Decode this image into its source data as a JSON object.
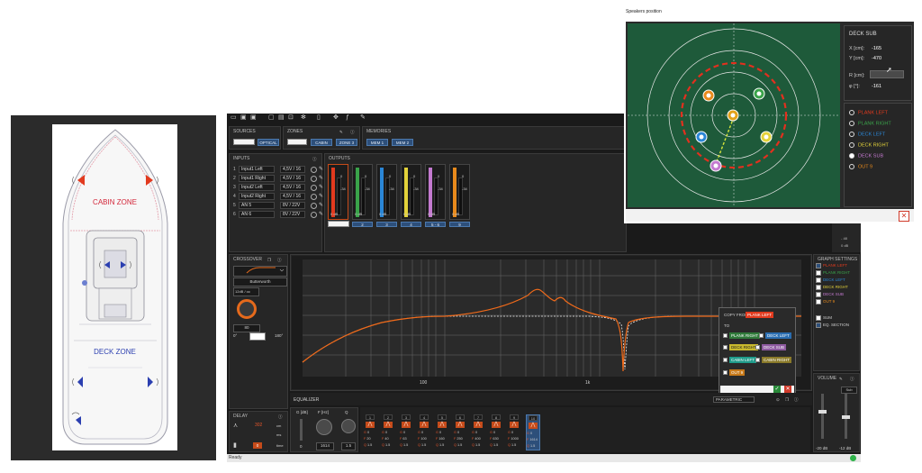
{
  "boat": {
    "cabin_zone_label": "CABIN ZONE",
    "deck_zone_label": "DECK ZONE"
  },
  "sources": {
    "title": "SOURCES",
    "item": "OPTICAL"
  },
  "zones": {
    "title": "ZONES",
    "items": [
      "CABIN",
      "ZONE 3"
    ]
  },
  "memories": {
    "title": "MEMORIES",
    "items": [
      "MEM 1",
      "MEM 2"
    ]
  },
  "inputs": {
    "title": "INPUTS",
    "rows": [
      {
        "num": "1",
        "name": "Input1 Left",
        "gain": "4,5V / 16"
      },
      {
        "num": "2",
        "name": "Input1 Right",
        "gain": "4,5V / 16"
      },
      {
        "num": "3",
        "name": "Input2 Left",
        "gain": "4,5V / 16"
      },
      {
        "num": "4",
        "name": "Input2 Right",
        "gain": "4,5V / 16"
      },
      {
        "num": "5",
        "name": "AN 5",
        "gain": "8V / 22V"
      },
      {
        "num": "6",
        "name": "AN 6",
        "gain": "8V / 22V"
      }
    ]
  },
  "outputs": {
    "title": "OUTPUTS",
    "strips": [
      {
        "color": "#e23a1e",
        "db1": "0",
        "db2": "-34",
        "level": "0 dB",
        "button": "1",
        "highlight": true
      },
      {
        "color": "#3aa34a",
        "db1": "0",
        "db2": "-34",
        "level": "0 dB",
        "button": "2"
      },
      {
        "color": "#2a86d6",
        "db1": "0",
        "db2": "-34",
        "level": "0 dB",
        "button": "3"
      },
      {
        "color": "#e3d23a",
        "db1": "0",
        "db2": "-34",
        "level": "0 dB",
        "button": "4"
      },
      {
        "color": "#c47ad0",
        "db1": "0",
        "db2": "-34",
        "level": "0 dB",
        "button": "5 - 6"
      },
      {
        "color": "#e88a1c",
        "db1": "0",
        "db2": "-34",
        "level": "0 dB",
        "button": "9"
      }
    ]
  },
  "crossover": {
    "title": "CROSSOVER",
    "filter": "Butterworth",
    "slope": "12dB / oc",
    "value": "80",
    "phase_min": "0°",
    "phase_max": "180°"
  },
  "graph": {
    "x_labels": [
      "100",
      "1k"
    ]
  },
  "graph_settings": {
    "title": "GRAPH SETTINGS",
    "items": [
      {
        "label": "PLANK LEFT",
        "color": "#e23a1e",
        "checked": true
      },
      {
        "label": "PLANK RIGHT",
        "color": "#3aa34a",
        "checked": false
      },
      {
        "label": "DECK LEFT",
        "color": "#2a86d6",
        "checked": false
      },
      {
        "label": "DECK RIGHT",
        "color": "#e3d23a",
        "checked": false
      },
      {
        "label": "DECK SUB",
        "color": "#c47ad0",
        "checked": false
      },
      {
        "label": "OUT 9",
        "color": "#e88a1c",
        "checked": false
      }
    ],
    "sum_label": "SUM",
    "eq_section_label": "EQ. SECTION"
  },
  "copy_dialog": {
    "copy_from": "COPY FROM",
    "source": "PLANK LEFT",
    "to_label": "TO",
    "targets": [
      {
        "label": "PLANK RIGHT",
        "color": "#2f7a3a"
      },
      {
        "label": "DECK LEFT",
        "color": "#2a6db0"
      },
      {
        "label": "DECK RIGHT",
        "color": "#c8b92d"
      },
      {
        "label": "DECK SUB",
        "color": "#8e5aa0"
      },
      {
        "label": "CABIN LEFT",
        "color": "#1f9b8a"
      },
      {
        "label": "CABIN RIGHT",
        "color": "#8a7a2a"
      },
      {
        "label": "OUT 9",
        "color": "#c87a1a"
      }
    ]
  },
  "equalizer": {
    "title": "EQUALIZER",
    "mode": "PARAMETRIC",
    "g_label": "G [dB]",
    "f_label": "F [Hz]",
    "q_label": "Q",
    "g_value": "0",
    "f_value": "1614",
    "q_value": "1.5",
    "bands": [
      {
        "n": "1",
        "g": "0",
        "f": "20",
        "q": "1.5"
      },
      {
        "n": "2",
        "g": "0",
        "f": "40",
        "q": "1.5"
      },
      {
        "n": "3",
        "g": "0",
        "f": "63",
        "q": "1.5"
      },
      {
        "n": "4",
        "g": "0",
        "f": "100",
        "q": "1.5"
      },
      {
        "n": "5",
        "g": "0",
        "f": "160",
        "q": "1.5"
      },
      {
        "n": "6",
        "g": "0",
        "f": "250",
        "q": "1.5"
      },
      {
        "n": "7",
        "g": "0",
        "f": "400",
        "q": "1.5"
      },
      {
        "n": "8",
        "g": "0",
        "f": "630",
        "q": "1.5"
      },
      {
        "n": "9",
        "g": "0",
        "f": "1000",
        "q": "1.5"
      },
      {
        "n": "10",
        "g": "0",
        "f": "1614",
        "q": "1.5",
        "selected": true
      }
    ]
  },
  "delay": {
    "title": "DELAY",
    "value": "0",
    "unit_cm": "cm",
    "unit_ms": "ms",
    "unit_time": "time",
    "color_value": "302"
  },
  "volume": {
    "title": "VOLUME",
    "level1": "-20 dB",
    "level2": "-12 dB",
    "top_value": "Sub"
  },
  "status": {
    "text": "Ready"
  },
  "speakers": {
    "window_title": "Speakers position",
    "selected_title": "DECK SUB",
    "x_label": "X [cm]:",
    "x_value": "-165",
    "y_label": "Y [cm]:",
    "y_value": "-470",
    "r_label": "R [cm]:",
    "phi_label": "φ [°]:",
    "phi_value": "-161",
    "list": [
      {
        "label": "PLANK LEFT",
        "color": "#e23a1e"
      },
      {
        "label": "PLANK RIGHT",
        "color": "#3aa34a"
      },
      {
        "label": "DECK LEFT",
        "color": "#2a86d6"
      },
      {
        "label": "DECK RIGHT",
        "color": "#e3d23a"
      },
      {
        "label": "DECK SUB",
        "color": "#c47ad0",
        "selected": true
      },
      {
        "label": "OUT 9",
        "color": "#e88a1c"
      }
    ]
  },
  "colors": {
    "accent_orange": "#e56a1c",
    "button_blue": "#2d4f7a",
    "radar_green": "#1e5a3a"
  }
}
